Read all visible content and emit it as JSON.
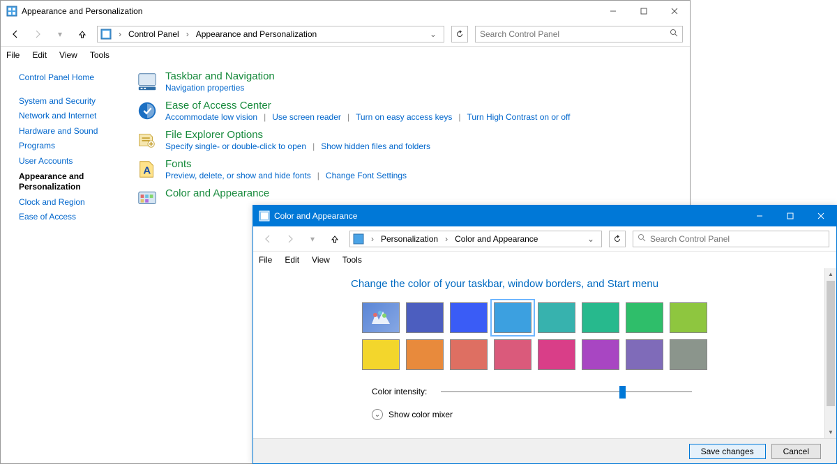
{
  "win1": {
    "title": "Appearance and Personalization",
    "breadcrumb": [
      "Control Panel",
      "Appearance and Personalization"
    ],
    "search_placeholder": "Search Control Panel",
    "menus": [
      "File",
      "Edit",
      "View",
      "Tools"
    ]
  },
  "sidebar": {
    "items": [
      {
        "label": "Control Panel Home",
        "bold": false
      },
      {
        "label": "System and Security",
        "bold": false
      },
      {
        "label": "Network and Internet",
        "bold": false
      },
      {
        "label": "Hardware and Sound",
        "bold": false
      },
      {
        "label": "Programs",
        "bold": false
      },
      {
        "label": "User Accounts",
        "bold": false
      },
      {
        "label": "Appearance and Personalization",
        "bold": true
      },
      {
        "label": "Clock and Region",
        "bold": false
      },
      {
        "label": "Ease of Access",
        "bold": false
      }
    ]
  },
  "categories": [
    {
      "title": "Taskbar and Navigation",
      "links": [
        "Navigation properties"
      ]
    },
    {
      "title": "Ease of Access Center",
      "links": [
        "Accommodate low vision",
        "Use screen reader",
        "Turn on easy access keys",
        "Turn High Contrast on or off"
      ]
    },
    {
      "title": "File Explorer Options",
      "links": [
        "Specify single- or double-click to open",
        "Show hidden files and folders"
      ]
    },
    {
      "title": "Fonts",
      "links": [
        "Preview, delete, or show and hide fonts",
        "Change Font Settings"
      ]
    },
    {
      "title": "Color and Appearance",
      "links": []
    }
  ],
  "win2": {
    "title": "Color and Appearance",
    "breadcrumb": [
      "Personalization",
      "Color and Appearance"
    ],
    "search_placeholder": "Search Control Panel",
    "menus": [
      "File",
      "Edit",
      "View",
      "Tools"
    ],
    "heading": "Change the color of your taskbar, window borders, and Start menu",
    "intensity_label": "Color intensity:",
    "intensity_value": 0.72,
    "mixer_label": "Show color mixer",
    "save_label": "Save changes",
    "cancel_label": "Cancel",
    "selected_index": 3,
    "swatches": [
      {
        "automatic": true,
        "color": "#6d8fd8"
      },
      {
        "color": "#4c5ebf"
      },
      {
        "color": "#3a5cf6"
      },
      {
        "color": "#3ca0e0"
      },
      {
        "color": "#37b2ae"
      },
      {
        "color": "#27b98d"
      },
      {
        "color": "#2fbe6a"
      },
      {
        "color": "#8ec63f"
      },
      {
        "color": "#f3d62c"
      },
      {
        "color": "#e88a3c"
      },
      {
        "color": "#de6f62"
      },
      {
        "color": "#da5a7b"
      },
      {
        "color": "#d93e88"
      },
      {
        "color": "#a846c2"
      },
      {
        "color": "#7f6bb9"
      },
      {
        "color": "#8b958c"
      }
    ]
  }
}
